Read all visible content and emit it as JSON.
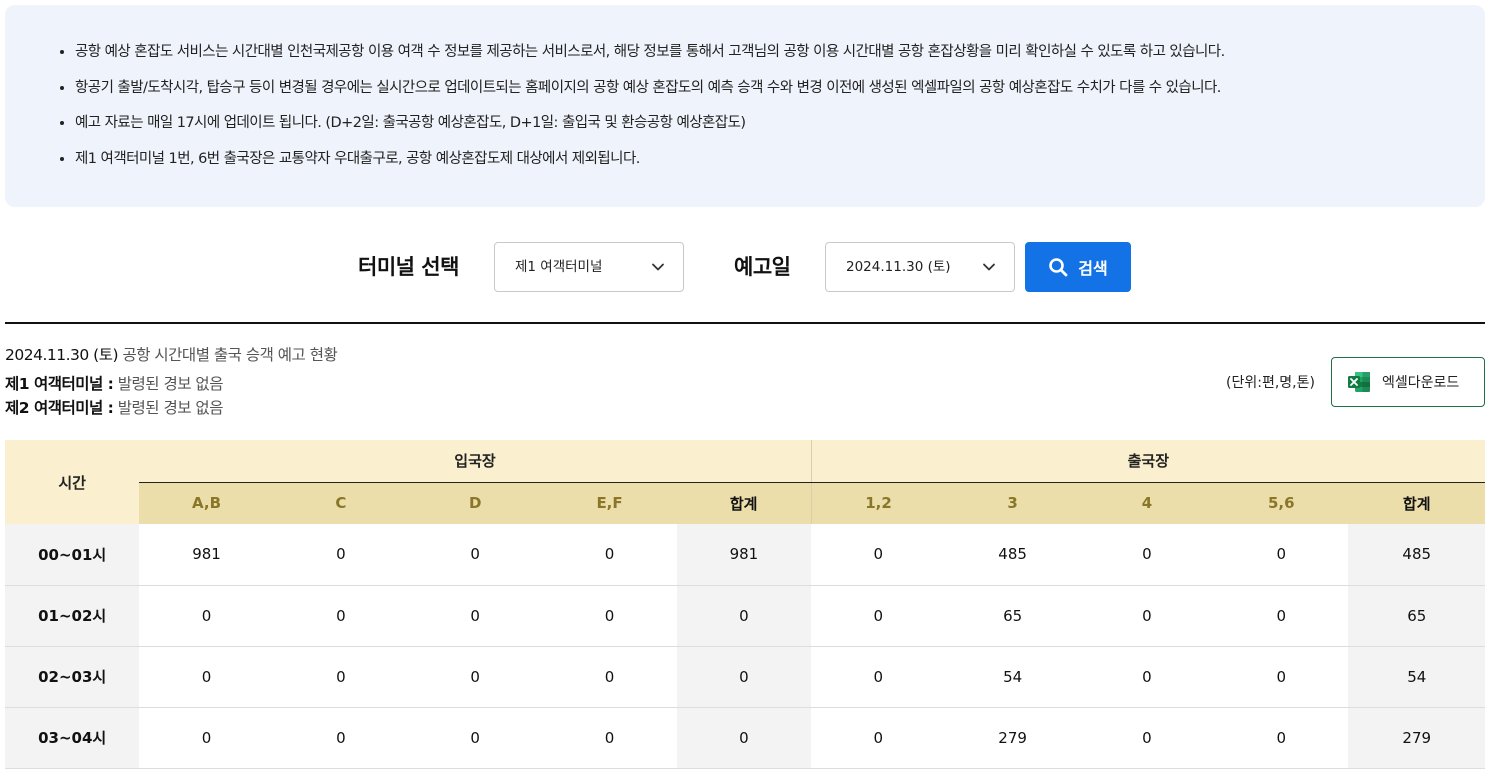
{
  "notice": {
    "items": [
      "공항 예상 혼잡도 서비스는 시간대별 인천국제공항 이용 여객 수 정보를 제공하는 서비스로서, 해당 정보를 통해서 고객님의 공항 이용 시간대별 공항 혼잡상황을 미리 확인하실 수 있도록 하고 있습니다.",
      "항공기 출발/도착시각, 탑승구 등이 변경될 경우에는 실시간으로 업데이트되는 홈페이지의 공항 예상 혼잡도의 예측 승객 수와 변경 이전에 생성된 엑셀파일의 공항 예상혼잡도 수치가 다를 수 있습니다.",
      "예고 자료는 매일 17시에 업데이트 됩니다. (D+2일: 출국공항 예상혼잡도, D+1일: 출입국 및 환승공항 예상혼잡도)",
      "제1 여객터미널 1번, 6번 출국장은 교통약자 우대출구로, 공항 예상혼잡도제 대상에서 제외됩니다."
    ]
  },
  "search": {
    "terminal_label": "터미널 선택",
    "terminal_value": "제1 여객터미널",
    "date_label": "예고일",
    "date_value": "2024.11.30 (토)",
    "button_label": "검색"
  },
  "info": {
    "date": "2024.11.30 (토)",
    "title": "공항 시간대별 출국 승객 예고 현황",
    "t1_name": "제1 여객터미널 :",
    "t1_status": "발령된 경보 없음",
    "t2_name": "제2 여객터미널 :",
    "t2_status": "발령된 경보 없음",
    "unit": "(단위:편,명,톤)",
    "excel_label": "엑셀다운로드"
  },
  "table": {
    "time_header": "시간",
    "arrival_header": "입국장",
    "departure_header": "출국장",
    "arrival_cols": [
      "A,B",
      "C",
      "D",
      "E,F",
      "합계"
    ],
    "departure_cols": [
      "1,2",
      "3",
      "4",
      "5,6",
      "합계"
    ],
    "rows": [
      {
        "time": "00~01시",
        "arrival": [
          "981",
          "0",
          "0",
          "0",
          "981"
        ],
        "departure": [
          "0",
          "485",
          "0",
          "0",
          "485"
        ]
      },
      {
        "time": "01~02시",
        "arrival": [
          "0",
          "0",
          "0",
          "0",
          "0"
        ],
        "departure": [
          "0",
          "65",
          "0",
          "0",
          "65"
        ]
      },
      {
        "time": "02~03시",
        "arrival": [
          "0",
          "0",
          "0",
          "0",
          "0"
        ],
        "departure": [
          "0",
          "54",
          "0",
          "0",
          "54"
        ]
      },
      {
        "time": "03~04시",
        "arrival": [
          "0",
          "0",
          "0",
          "0",
          "0"
        ],
        "departure": [
          "0",
          "279",
          "0",
          "0",
          "279"
        ]
      }
    ]
  },
  "colors": {
    "accent": "#1373e6",
    "notice_bg": "#eff3fb",
    "header_bg": "#faf0cf",
    "subheader_bg": "#ecdeaa",
    "excel_green": "#1e7145"
  },
  "icons": {
    "search": "search-icon",
    "chevron": "chevron-down-icon",
    "excel": "excel-icon"
  }
}
